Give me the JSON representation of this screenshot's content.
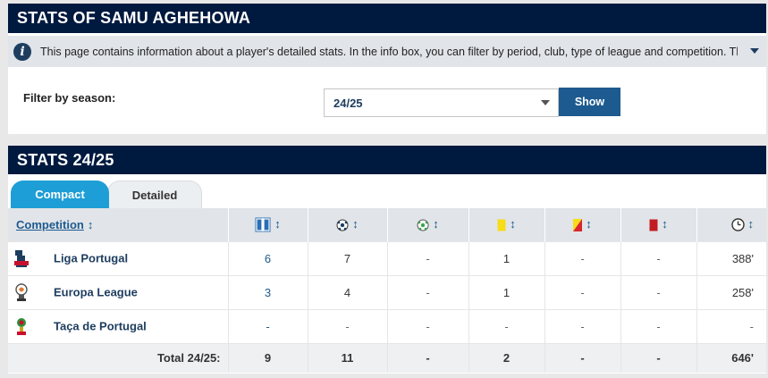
{
  "header": {
    "title": "STATS OF SAMU AGHEHOWA"
  },
  "info": {
    "text": "This page contains information about a player's detailed stats. In the info box, you can filter by period, club, type of league and competition. Th..."
  },
  "filter": {
    "label": "Filter by season:",
    "selected": "24/25",
    "button": "Show"
  },
  "stats": {
    "title": "STATS 24/25",
    "tabs": [
      "Compact",
      "Detailed"
    ],
    "columns": {
      "competition": "Competition",
      "sort_arrow": "↕",
      "icons": [
        "appearances-icon",
        "goals-icon",
        "assists-icon",
        "yellow-card-icon",
        "second-yellow-card-icon",
        "red-card-icon",
        "minutes-played-icon"
      ]
    },
    "rows": [
      {
        "name": "Liga Portugal",
        "apps": "6",
        "goals": "7",
        "assists": "-",
        "yellow": "1",
        "second_yellow": "-",
        "red": "-",
        "minutes": "388'"
      },
      {
        "name": "Europa League",
        "apps": "3",
        "goals": "4",
        "assists": "-",
        "yellow": "1",
        "second_yellow": "-",
        "red": "-",
        "minutes": "258'"
      },
      {
        "name": "Taça de Portugal",
        "apps": "-",
        "goals": "-",
        "assists": "-",
        "yellow": "-",
        "second_yellow": "-",
        "red": "-",
        "minutes": "-"
      }
    ],
    "total": {
      "label": "Total 24/25:",
      "apps": "9",
      "goals": "11",
      "assists": "-",
      "yellow": "2",
      "second_yellow": "-",
      "red": "-",
      "minutes": "646'"
    }
  },
  "colors": {
    "header_bg": "#00193f",
    "tab_active": "#1e9ed6",
    "button": "#1d5a8f",
    "link": "#1d5a8f"
  }
}
